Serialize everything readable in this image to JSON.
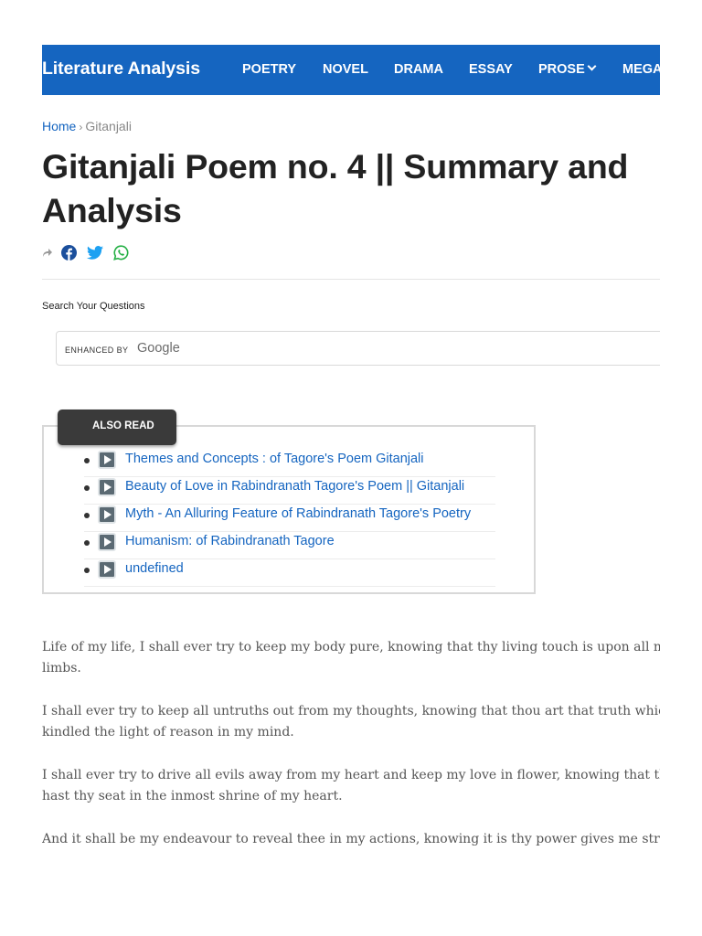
{
  "header": {
    "brand": "Literature Analysis",
    "nav": [
      "POETRY",
      "NOVEL",
      "DRAMA",
      "ESSAY",
      "PROSE",
      "MEGA"
    ],
    "accent": "#1565c0"
  },
  "breadcrumb": {
    "home": "Home",
    "separator": "›",
    "current": "Gitanjali"
  },
  "article": {
    "title_lines": [
      "Gitanjali Poem no. 4 || Summary and",
      "Analysis"
    ],
    "share_icons": [
      "share-icon",
      "facebook-icon",
      "twitter-icon",
      "whatsapp-icon"
    ]
  },
  "search": {
    "label": "Search Your Questions",
    "enhanced_by": "ENHANCED BY",
    "provider": "Google"
  },
  "also_read": {
    "heading": "ALSO READ",
    "items": [
      "Themes and Concepts : of Tagore's Poem Gitanjali",
      "Beauty of Love in Rabindranath Tagore's Poem || Gitanjali",
      "Myth - An Alluring Feature of Rabindranath Tagore's Poetry",
      "Humanism: of Rabindranath Tagore",
      "undefined"
    ]
  },
  "poem": {
    "paragraphs": [
      [
        "Life of my life, I shall ever try to keep my body pure, knowing that thy living touch is upon all my",
        "limbs."
      ],
      [
        "I shall ever try to keep all untruths out from my thoughts, knowing that thou art that truth which has",
        "kindled the light of reason in my mind."
      ],
      [
        "I shall ever try to drive all evils away from my heart and keep my love in flower, knowing that thou",
        "hast thy seat in the inmost shrine of my heart."
      ],
      [
        "And it shall be my endeavour to reveal thee in my actions, knowing it is thy power gives me strength to act."
      ]
    ]
  }
}
